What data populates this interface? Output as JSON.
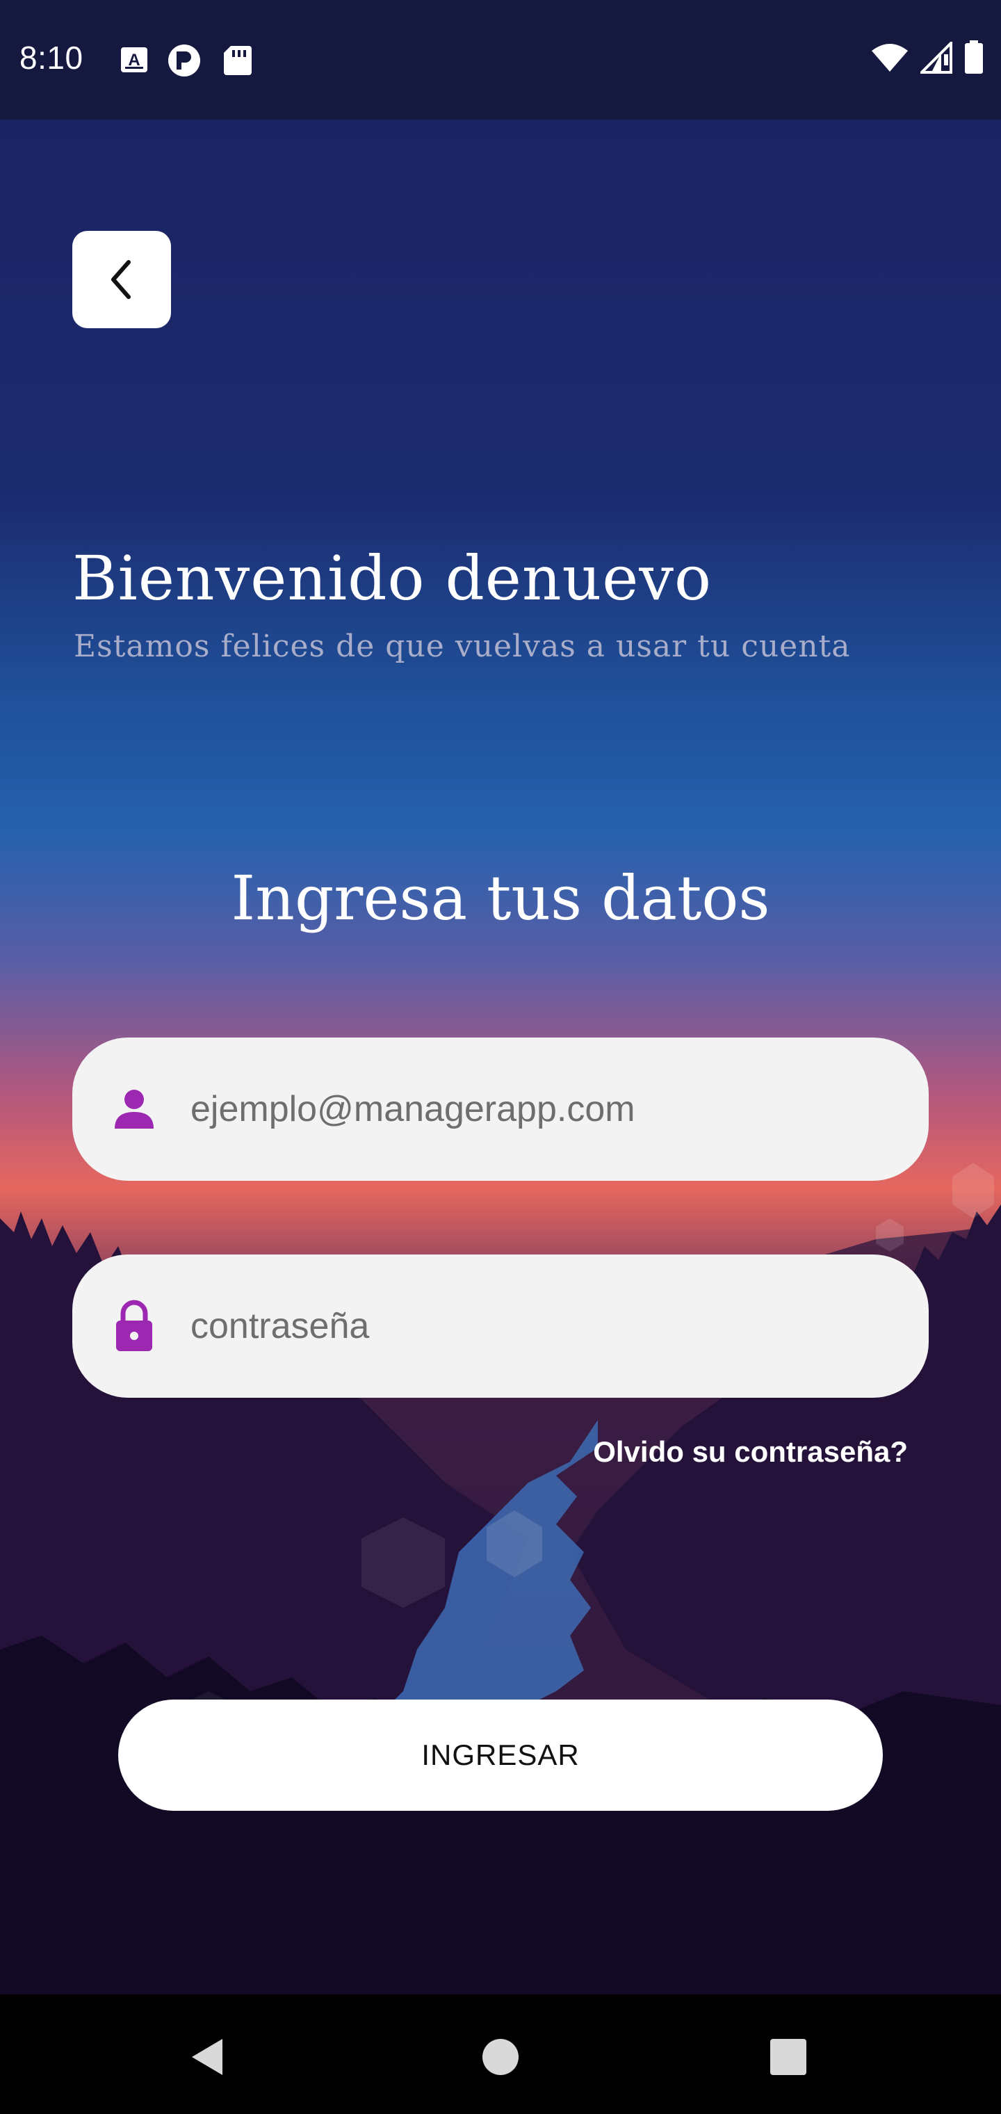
{
  "status_bar": {
    "time": "8:10",
    "notification_icons": [
      "a-keyboard-icon",
      "p-app-icon",
      "sd-card-icon"
    ],
    "system_icons": [
      "wifi-icon",
      "signal-icon",
      "battery-icon"
    ]
  },
  "header": {
    "back_icon": "chevron-left-icon"
  },
  "welcome": {
    "title": "Bienvenido denuevo",
    "subtitle": "Estamos felices de que vuelvas a usar tu cuenta"
  },
  "form": {
    "section_title": "Ingresa tus datos",
    "email": {
      "icon": "person-icon",
      "placeholder": "ejemplo@managerapp.com",
      "value": ""
    },
    "password": {
      "icon": "lock-icon",
      "placeholder": "contraseña",
      "value": ""
    },
    "forgot_label": "Olvido su contraseña?",
    "submit_label": "INGRESAR"
  },
  "colors": {
    "accent": "#9c27b0",
    "field_bg": "#f4f3f4",
    "top_bg": "#1b2363"
  },
  "nav_bar": {
    "buttons": [
      "back-triangle-icon",
      "home-circle-icon",
      "recents-square-icon"
    ]
  }
}
